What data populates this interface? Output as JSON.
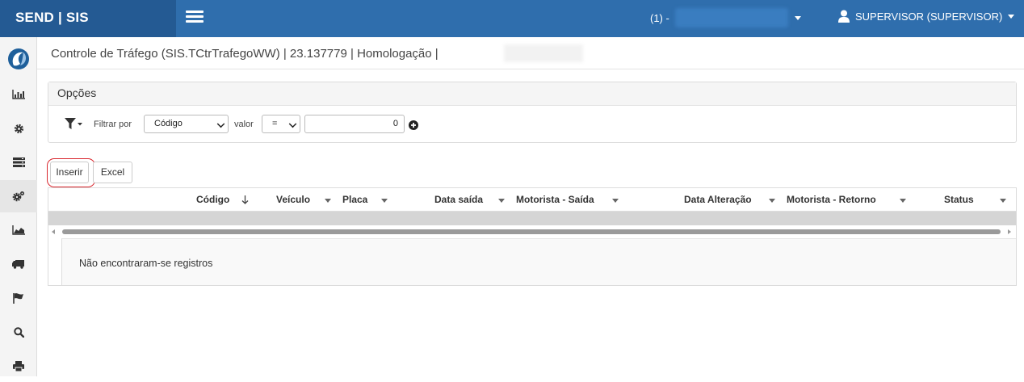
{
  "topbar": {
    "brand": "SEND | SIS",
    "company_prefix": "(1) -",
    "user_label": "SUPERVISOR (SUPERVISOR)"
  },
  "sidebar": {
    "items": [
      {
        "icon": "logo-icon"
      },
      {
        "icon": "bar-chart-icon"
      },
      {
        "icon": "gear-icon"
      },
      {
        "icon": "server-icon"
      },
      {
        "icon": "gears-icon",
        "active": true
      },
      {
        "icon": "area-chart-icon"
      },
      {
        "icon": "truck-icon"
      },
      {
        "icon": "flag-icon"
      },
      {
        "icon": "search-icon"
      },
      {
        "icon": "print-icon"
      }
    ]
  },
  "page": {
    "title": "Controle de Tráfego (SIS.TCtrTrafegoWW) | 23.137779 | Homologação |"
  },
  "options": {
    "header": "Opções",
    "filter_by_label": "Filtrar por",
    "field_select": "Código",
    "valor_label": "valor",
    "operator_select": "=",
    "value_input": "0"
  },
  "actions": {
    "insert_label": "Inserir",
    "excel_label": "Excel"
  },
  "grid": {
    "columns": [
      {
        "label": "Código"
      },
      {
        "label": "Veículo"
      },
      {
        "label": "Placa"
      },
      {
        "label": "Data saída"
      },
      {
        "label": "Motorista - Saída"
      },
      {
        "label": "Data Alteração"
      },
      {
        "label": "Motorista - Retorno"
      },
      {
        "label": "Status"
      }
    ],
    "empty_message": "Não encontraram-se registros"
  },
  "colors": {
    "topbar": "#2f6ead",
    "brand_bg": "#245a93",
    "highlight_ring": "#d9272e"
  }
}
